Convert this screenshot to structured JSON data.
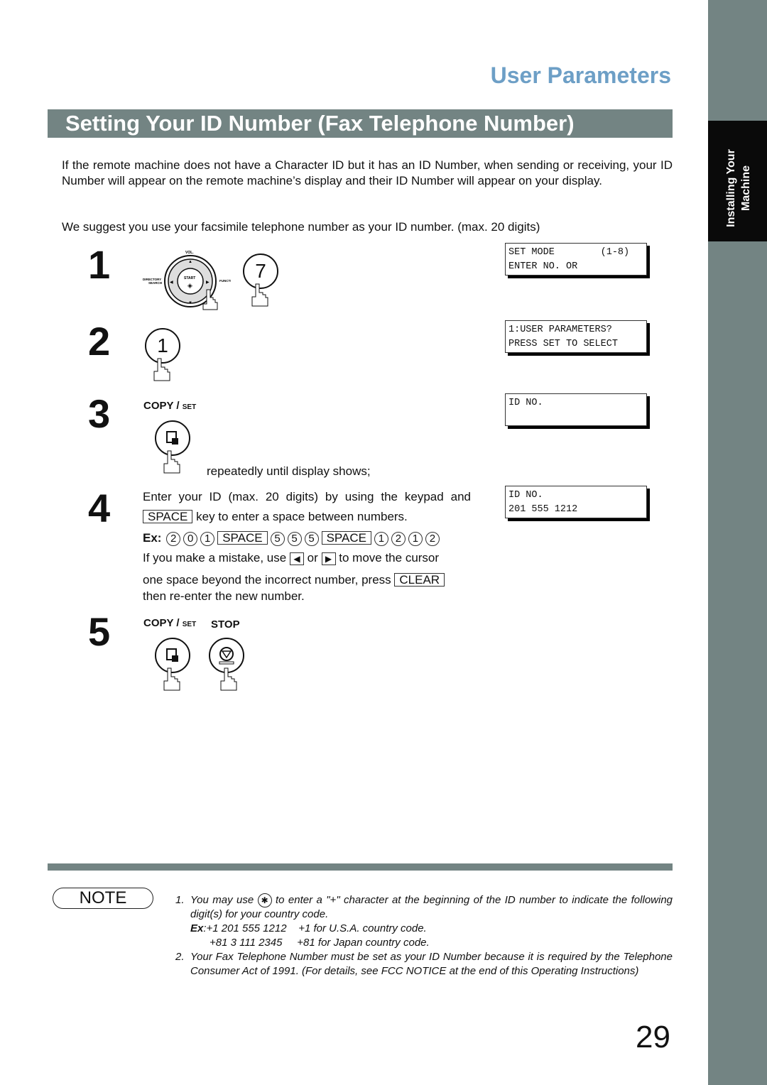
{
  "header": {
    "section_title": "User Parameters",
    "page_title": "Setting Your ID Number (Fax Telephone Number)"
  },
  "side_tab": {
    "label_line1": "Installing Your",
    "label_line2": "Machine"
  },
  "intro": {
    "paragraph1": "If the remote machine does not have a Character ID but it has an ID Number, when sending or receiving, your ID Number will appear on the remote machine’s display and their ID Number will appear on your display.",
    "paragraph2": "We suggest you use your facsimile telephone number as your ID number. (max. 20 digits)"
  },
  "steps": [
    {
      "number": "1",
      "keypad": {
        "vol": "VOL.",
        "start": "START",
        "directory": "DIRECTORY",
        "search": "SEARCH",
        "function": "FUNCTION"
      },
      "key": "7",
      "display": [
        "SET MODE        (1-8)",
        "ENTER NO. OR"
      ]
    },
    {
      "number": "2",
      "key": "1",
      "display": [
        "1:USER PARAMETERS?",
        "PRESS SET TO SELECT"
      ]
    },
    {
      "number": "3",
      "button_label": "COPY / ",
      "button_label_small": "SET",
      "instruction": "repeatedly until display shows;",
      "display": [
        "ID NO.",
        ""
      ]
    },
    {
      "number": "4",
      "line1": "Enter your ID (max. 20 digits) by using the keypad and",
      "space_key": "SPACE",
      "line2": "key to enter a space between numbers.",
      "example_label": "Ex:",
      "example_keys": [
        "2",
        "0",
        "1",
        "SPACE",
        "5",
        "5",
        "5",
        "SPACE",
        "1",
        "2",
        "1",
        "2"
      ],
      "mistake_a": "If you make a mistake, use",
      "left_arrow": "◀",
      "or": "or",
      "right_arrow": "▶",
      "mistake_b": "to move the cursor",
      "mistake_c": "one space beyond the incorrect number, press",
      "clear_key": "CLEAR",
      "mistake_d": "then re-enter the new number.",
      "display": [
        "ID NO.",
        "201 555 1212"
      ]
    },
    {
      "number": "5",
      "button1": "COPY / ",
      "button1_small": "SET",
      "button2": "STOP"
    }
  ],
  "note": {
    "badge": "NOTE",
    "items": [
      {
        "num": "1.",
        "text_a": "You may use",
        "text_b": "to enter a \"+\" character at the beginning of the ID number to indicate the following digit(s) for your country code.",
        "ex_label": "Ex",
        "ex1": ":+1 201 555 1212    +1 for U.S.A. country code.",
        "ex2": "+81 3 111 2345     +81 for Japan country code."
      },
      {
        "num": "2.",
        "text": "Your Fax Telephone Number must be set as your ID Number because it is required by the Telephone Consumer Act of 1991. (For details, see FCC NOTICE at the end of this Operating Instructions)"
      }
    ]
  },
  "page_number": "29"
}
